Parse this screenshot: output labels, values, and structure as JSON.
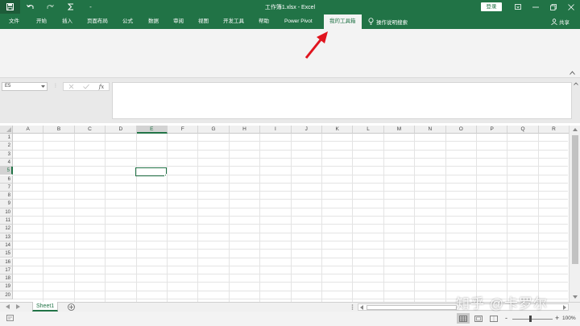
{
  "window": {
    "title": "工作簿1.xlsx - Excel",
    "login_label": "登录"
  },
  "qat": {
    "customize_label": "-"
  },
  "tabs": [
    {
      "label": "文件"
    },
    {
      "label": "开始"
    },
    {
      "label": "插入"
    },
    {
      "label": "页面布局"
    },
    {
      "label": "公式"
    },
    {
      "label": "数据"
    },
    {
      "label": "审阅"
    },
    {
      "label": "视图"
    },
    {
      "label": "开发工具"
    },
    {
      "label": "帮助"
    },
    {
      "label": "Power Pivot"
    },
    {
      "label": "我的工具箱"
    }
  ],
  "active_tab": "我的工具箱",
  "tell_me": "操作说明搜索",
  "share": "共享",
  "formula_bar": {
    "name_box": "E5",
    "formula": "",
    "fx_label": "fx"
  },
  "grid": {
    "columns": [
      "A",
      "B",
      "C",
      "D",
      "E",
      "F",
      "G",
      "H",
      "I",
      "J",
      "K",
      "L",
      "M",
      "N",
      "O",
      "P",
      "Q",
      "R"
    ],
    "rows": [
      "1",
      "2",
      "3",
      "4",
      "5",
      "6",
      "7",
      "8",
      "9",
      "10",
      "11",
      "12",
      "13",
      "14",
      "15",
      "16",
      "17",
      "18",
      "19",
      "20"
    ],
    "selected_cell": "E5"
  },
  "sheets": [
    {
      "label": "Sheet1",
      "active": true
    }
  ],
  "status": {
    "zoom": "100%",
    "zoom_minus": "-",
    "zoom_plus": "+"
  },
  "watermark": "知乎 @卡罗尔",
  "colors": {
    "excel_green": "#217346",
    "arrow_red": "#e0141e"
  }
}
